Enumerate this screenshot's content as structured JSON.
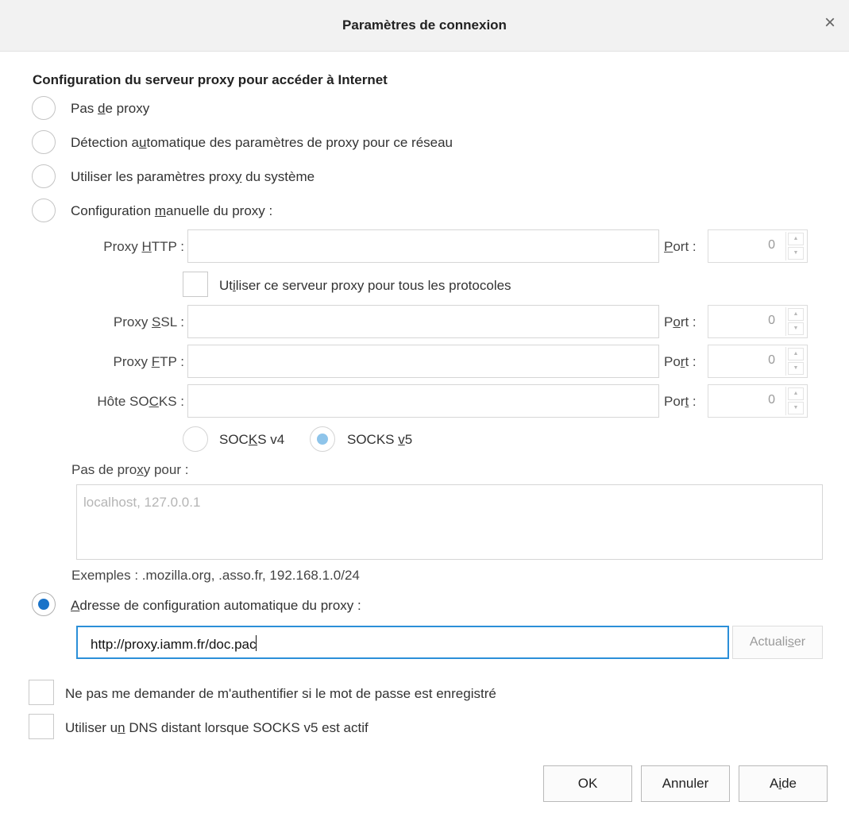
{
  "dialog": {
    "title": "Paramètres de connexion",
    "close_glyph": "×"
  },
  "proxy_config": {
    "heading": "Configuration du serveur proxy pour accéder à Internet",
    "options": [
      {
        "pre": "Pas ",
        "key": "d",
        "post": "e proxy",
        "checked": false
      },
      {
        "pre": "Détection a",
        "key": "u",
        "post": "tomatique des paramètres de proxy pour ce réseau",
        "checked": false
      },
      {
        "pre": "Utiliser les paramètres prox",
        "key": "y",
        "post": " du système",
        "checked": false
      },
      {
        "pre": "Configuration ",
        "key": "m",
        "post": "anuelle du proxy :",
        "checked": false
      }
    ]
  },
  "manual": {
    "http": {
      "pre": "Proxy ",
      "key": "H",
      "post": "TTP :",
      "value": "",
      "port_pre": "",
      "port_key": "P",
      "port_post": "ort :",
      "port": "0"
    },
    "use_for_all": {
      "pre": "Ut",
      "key": "i",
      "post": "liser ce serveur proxy pour tous les protocoles",
      "checked": false
    },
    "ssl": {
      "pre": "Proxy ",
      "key": "S",
      "post": "SL :",
      "value": "",
      "port_pre": "P",
      "port_key": "o",
      "port_post": "rt :",
      "port": "0"
    },
    "ftp": {
      "pre": "Proxy ",
      "key": "F",
      "post": "TP :",
      "value": "",
      "port_pre": "Po",
      "port_key": "r",
      "port_post": "t :",
      "port": "0"
    },
    "socks": {
      "pre": "Hôte SO",
      "key": "C",
      "post": "KS :",
      "value": "",
      "port_pre": "Por",
      "port_key": "t",
      "port_post": " :",
      "port": "0"
    },
    "socks_v4": {
      "pre": "SOC",
      "key": "K",
      "post": "S v4",
      "checked": false
    },
    "socks_v5": {
      "pre": "SOCKS ",
      "key": "v",
      "post": "5",
      "checked": true
    }
  },
  "no_proxy": {
    "label_pre": "Pas de pro",
    "label_key": "x",
    "label_post": "y pour :",
    "placeholder": "localhost, 127.0.0.1",
    "examples": "Exemples : .mozilla.org, .asso.fr, 192.168.1.0/24"
  },
  "auto_config": {
    "pre": "",
    "key": "A",
    "post": "dresse de configuration automatique du proxy :",
    "checked": true,
    "url": "http://proxy.iamm.fr/doc.pac",
    "refresh_pre": "Actuali",
    "refresh_key": "s",
    "refresh_post": "er"
  },
  "options": {
    "no_auth_prompt": {
      "pre": "Ne pas me demander de m'authentifier si le mot de passe est enre",
      "key": "g",
      "post": "istré",
      "checked": false
    },
    "remote_dns": {
      "pre": "Utiliser u",
      "key": "n",
      "post": " DNS distant lorsque SOCKS v5 est actif",
      "checked": false
    }
  },
  "buttons": {
    "ok": "OK",
    "cancel": "Annuler",
    "help_pre": "A",
    "help_key": "i",
    "help_post": "de"
  },
  "colors": {
    "accent": "#1a73c8",
    "focus_border": "#2b8fd8",
    "disabled_accent": "#8ec4ea",
    "titlebar_bg": "#f2f2f2"
  }
}
